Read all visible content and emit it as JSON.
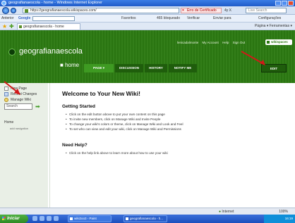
{
  "window": {
    "title": "geografianaescola - home - Windows Internet Explorer"
  },
  "address_bar": {
    "url": "https://geografianaescola.wikispaces.com/",
    "cert_error": "Erro de Certificado",
    "misc": "4y  X",
    "search_placeholder": "Live Search"
  },
  "toolbar": {
    "anterior": "Anterior",
    "google_label": "Google",
    "favorites": "Favoritos",
    "items": "465 bloqueado",
    "verificar": "Verificar",
    "enviar": "Enviar para",
    "configuracoes": "Configurações"
  },
  "tabs": {
    "page_tab_label": "geografianaescola - home",
    "right_tools": "Página ▾   Ferramentas ▾"
  },
  "wiki": {
    "name": "geografianaescola",
    "user_links": [
      "lenicadalmonte",
      "My Account",
      "Help",
      "Sign Out"
    ],
    "badge": "wikispaces",
    "home_label": "home",
    "nav_tabs": [
      "PAGE",
      "DISCUSSION",
      "HISTORY",
      "NOTIFY ME"
    ],
    "edit_label": "EDIT"
  },
  "sidebar": {
    "new_page": "New Page",
    "recent_changes": "Recent Changes",
    "manage_wiki": "Manage Wiki",
    "search_value": "Search",
    "home": "Home",
    "add_navigation": "add navigation"
  },
  "content": {
    "welcome_title": "Welcome to Your New Wiki!",
    "getting_started": "Getting Started",
    "bullets": [
      "Click on the edit button above to put your own content on this page",
      "To invite new members, click on Manage Wiki and Invite People",
      "To change your wiki's colors or theme, click on Manage Wiki and Look and Feel",
      "To set who can view and edit your wiki, click on Manage Wiki and Permissions"
    ],
    "need_help": "Need Help?",
    "help_bullet": "Click on the help link above to learn more about how to use your wiki"
  },
  "status_bar": {
    "zone": "Internet",
    "zoom": "100%"
  },
  "taskbar": {
    "start": "Iniciar",
    "task1": "wiki2oo3 - Paint",
    "task2": "geografianaescola - h...",
    "clock": "16:19"
  },
  "colors": {
    "wiki_green": "#2c7a12",
    "wiki_dark_green": "#1f5d0c",
    "sidebar_bg": "#e9efe6",
    "annotation_red": "#d21919"
  }
}
